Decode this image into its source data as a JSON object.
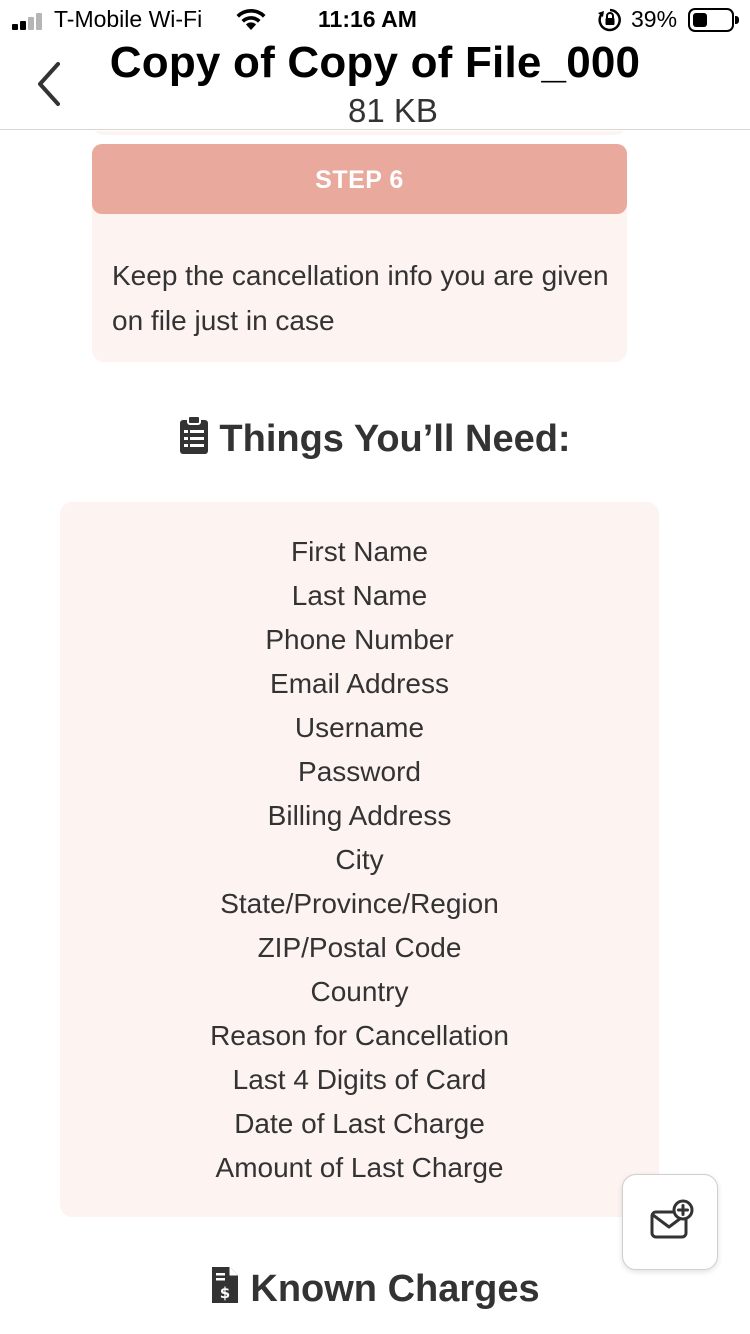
{
  "status_bar": {
    "carrier": "T-Mobile Wi-Fi",
    "time": "11:16 AM",
    "battery": "39%",
    "battery_level": 0.39,
    "signal_bars_filled": 2,
    "icons": [
      "signal-icon",
      "wifi-icon",
      "rotation-lock-icon",
      "battery-icon"
    ]
  },
  "header": {
    "title": "Copy of Copy of File_000",
    "file_size": "81 KB",
    "back_icon": "chevron-left-icon"
  },
  "step": {
    "label": "STEP 6",
    "text": "Keep the cancellation info you are given on file just in case"
  },
  "needs": {
    "heading": "Things You’ll Need:",
    "icon": "clipboard-list-icon",
    "items": [
      "First Name",
      "Last Name",
      "Phone Number",
      "Email Address",
      "Username",
      "Password",
      "Billing Address",
      "City",
      "State/Province/Region",
      "ZIP/Postal Code",
      "Country",
      "Reason for Cancellation",
      "Last 4 Digits of Card",
      "Date of Last Charge",
      "Amount of Last Charge"
    ]
  },
  "charges": {
    "heading": "Known Charges",
    "icon": "invoice-dollar-icon"
  },
  "fab": {
    "icon": "mail-add-icon"
  },
  "colors": {
    "step_header": "#e9a99c",
    "card_bg": "#fdf3f1",
    "text": "#333333"
  }
}
